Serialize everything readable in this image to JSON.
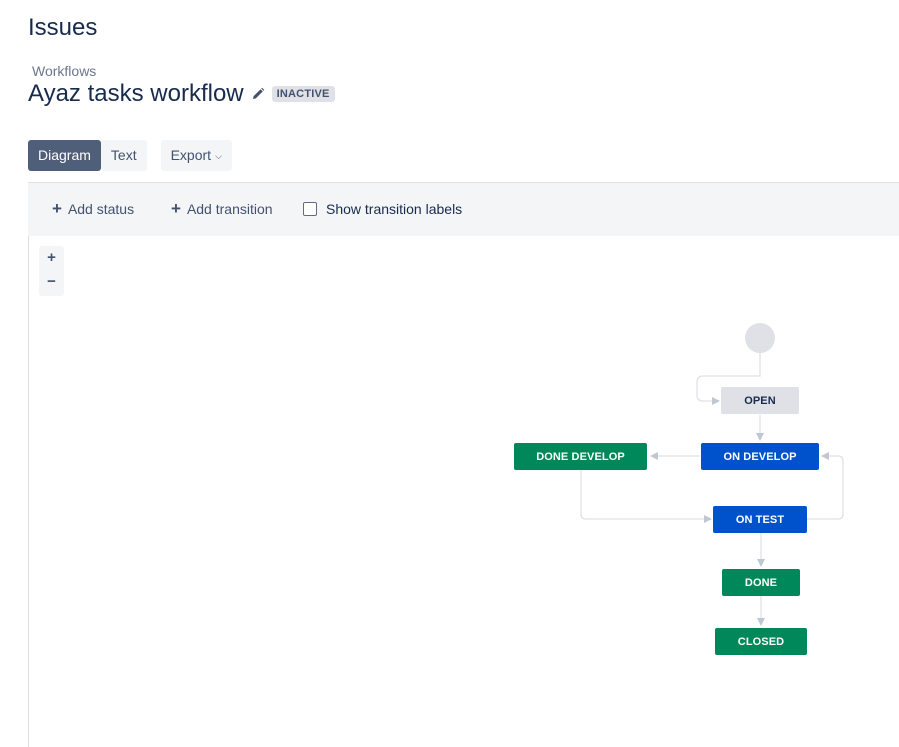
{
  "header": {
    "title": "Issues"
  },
  "breadcrumb": {
    "label": "Workflows"
  },
  "workflow": {
    "name": "Ayaz tasks workflow",
    "status": "INACTIVE"
  },
  "tabs": [
    {
      "label": "Diagram",
      "selected": true
    },
    {
      "label": "Text",
      "selected": false
    },
    {
      "label": "Export",
      "selected": false
    }
  ],
  "toolbar": {
    "add_status": "Add status",
    "add_transition": "Add transition",
    "show_labels": "Show transition labels",
    "show_labels_checked": false
  },
  "zoom": {
    "in": "+",
    "out": "−"
  },
  "diagram": {
    "statuses": {
      "open": "OPEN",
      "on_develop": "ON DEVELOP",
      "done_develop": "DONE DEVELOP",
      "on_test": "ON TEST",
      "done": "DONE",
      "closed": "CLOSED"
    },
    "transitions": [
      [
        "start",
        "OPEN"
      ],
      [
        "OPEN",
        "ON DEVELOP"
      ],
      [
        "ON DEVELOP",
        "DONE DEVELOP"
      ],
      [
        "DONE DEVELOP",
        "ON TEST"
      ],
      [
        "ON TEST",
        "ON DEVELOP"
      ],
      [
        "ON TEST",
        "DONE"
      ],
      [
        "DONE",
        "CLOSED"
      ]
    ]
  },
  "colors": {
    "todo": "#dfe1e6",
    "in_progress": "#0052cc",
    "done": "#00875a",
    "selected_tab": "#505f79"
  }
}
